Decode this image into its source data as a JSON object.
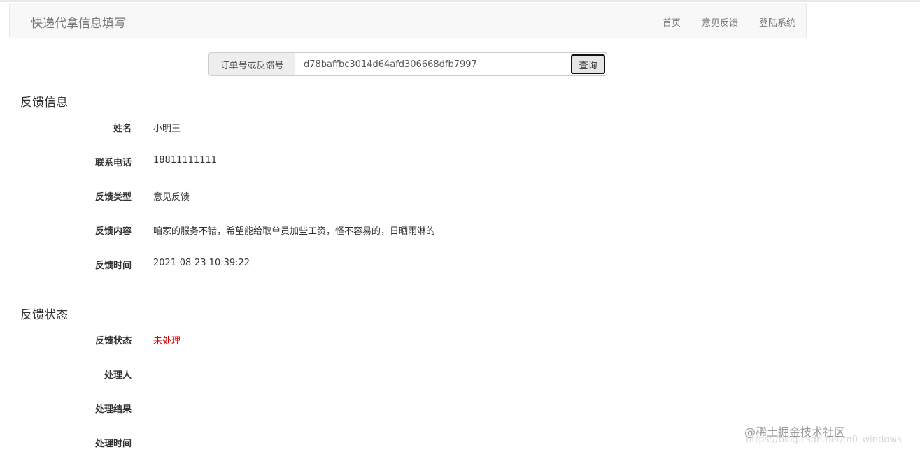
{
  "navbar": {
    "brand": "快递代拿信息填写",
    "links": [
      "首页",
      "意见反馈",
      "登陆系统"
    ]
  },
  "search": {
    "addon_label": "订单号或反馈号",
    "value": "d78baffbc3014d64afd306668dfb7997",
    "button_label": "查询"
  },
  "feedback_info": {
    "title": "反馈信息",
    "rows": [
      {
        "label": "姓名",
        "value": "小明王"
      },
      {
        "label": "联系电话",
        "value": "18811111111"
      },
      {
        "label": "反馈类型",
        "value": "意见反馈"
      },
      {
        "label": "反馈内容",
        "value": "咱家的服务不错，希望能给取单员加些工资，怪不容易的，日晒雨淋的"
      },
      {
        "label": "反馈时间",
        "value": "2021-08-23 10:39:22"
      }
    ]
  },
  "feedback_status": {
    "title": "反馈状态",
    "rows": [
      {
        "label": "反馈状态",
        "value": "未处理"
      },
      {
        "label": "处理人",
        "value": ""
      },
      {
        "label": "处理结果",
        "value": ""
      },
      {
        "label": "处理时间",
        "value": ""
      }
    ]
  },
  "colors": {
    "status_unprocessed": "#d10000",
    "navbar_bg": "#f8f8f8"
  },
  "watermark": {
    "text": "@稀土掘金技术社区",
    "url": "https://blog.csdn.net/m0_windows"
  }
}
